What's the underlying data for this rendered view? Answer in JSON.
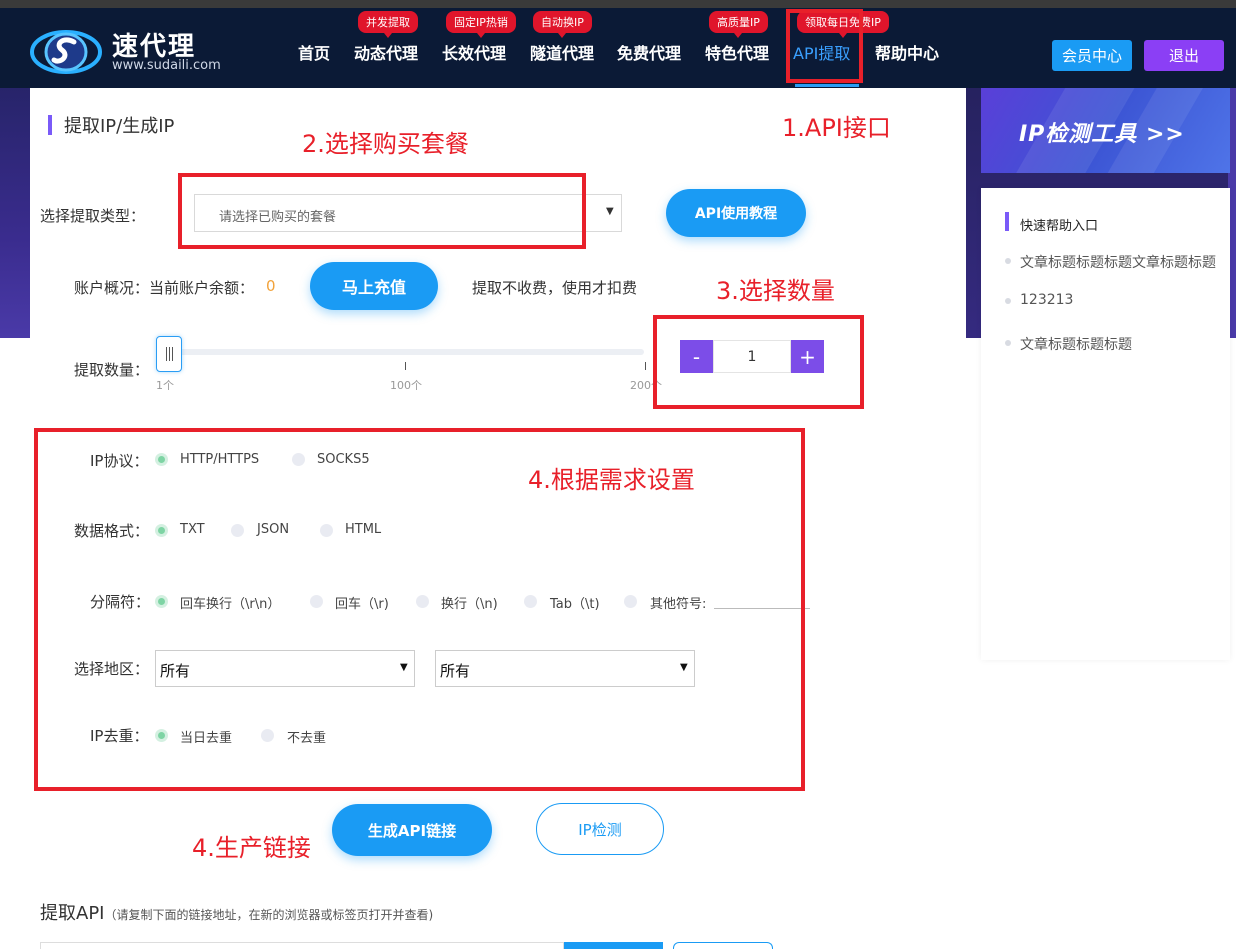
{
  "header": {
    "logo_name": "速代理",
    "logo_url": "www.sudaili.com",
    "nav": [
      {
        "label": "首页"
      },
      {
        "label": "动态代理",
        "badge": "并发提取"
      },
      {
        "label": "长效代理",
        "badge": "固定IP热销"
      },
      {
        "label": "隧道代理",
        "badge": "自动换IP"
      },
      {
        "label": "免费代理"
      },
      {
        "label": "特色代理",
        "badge": "高质量IP"
      },
      {
        "label": "API提取",
        "badge": "领取每日免费IP",
        "active": true
      },
      {
        "label": "帮助中心"
      }
    ],
    "member_button": "会员中心",
    "logout_button": "退出"
  },
  "main": {
    "title": "提取IP/生成IP",
    "type_label": "选择提取类型：",
    "package_placeholder": "请选择已购买的套餐",
    "api_tutorial_button": "API使用教程",
    "account_label": "账户概况：当前账户余额：",
    "balance": "0",
    "recharge_button": "马上充值",
    "fee_note": "提取不收费，使用才扣费",
    "quantity_label": "提取数量：",
    "slider_ticks": [
      "1个",
      "100个",
      "200个"
    ],
    "slider_value": 1,
    "quantity_value": "1",
    "stepper_minus": "-",
    "stepper_plus": "+",
    "protocol_label": "IP协议：",
    "protocol_options": [
      "HTTP/HTTPS",
      "SOCKS5"
    ],
    "protocol_selected": "HTTP/HTTPS",
    "format_label": "数据格式：",
    "format_options": [
      "TXT",
      "JSON",
      "HTML"
    ],
    "format_selected": "TXT",
    "separator_label": "分隔符：",
    "separator_options": [
      "回车换行（\\r\\n）",
      "回车（\\r)",
      "换行（\\n)",
      "Tab（\\t)",
      "其他符号:"
    ],
    "separator_selected": "回车换行（\\r\\n）",
    "region_label": "选择地区：",
    "region_province": "所有",
    "region_city": "所有",
    "dedup_label": "IP去重：",
    "dedup_options": [
      "当日去重",
      "不去重"
    ],
    "dedup_selected": "当日去重",
    "generate_button": "生成API链接",
    "ipcheck_button": "IP检测",
    "api_title": "提取API",
    "api_note": "（请复制下面的链接地址，在新的浏览器或标签页打开并查看)"
  },
  "sidebar": {
    "banner_text": "IP检测工具 >>",
    "help_title": "快速帮助入口",
    "help_items": [
      "文章标题标题标题文章标题标题",
      "123213",
      "文章标题标题标题"
    ]
  },
  "annotations": {
    "step1": "1.API接口",
    "step2": "2.选择购买套餐",
    "step3": "3.选择数量",
    "step4_settings": "4.根据需求设置",
    "step4_generate": "4.生产链接"
  },
  "colors": {
    "header_bg": "#0b1a36",
    "primary": "#1a9bf4",
    "purple": "#8b3ff5",
    "badge_red": "#e0152b",
    "annotation_red": "#e8202a",
    "balance_orange": "#f2a23a"
  }
}
